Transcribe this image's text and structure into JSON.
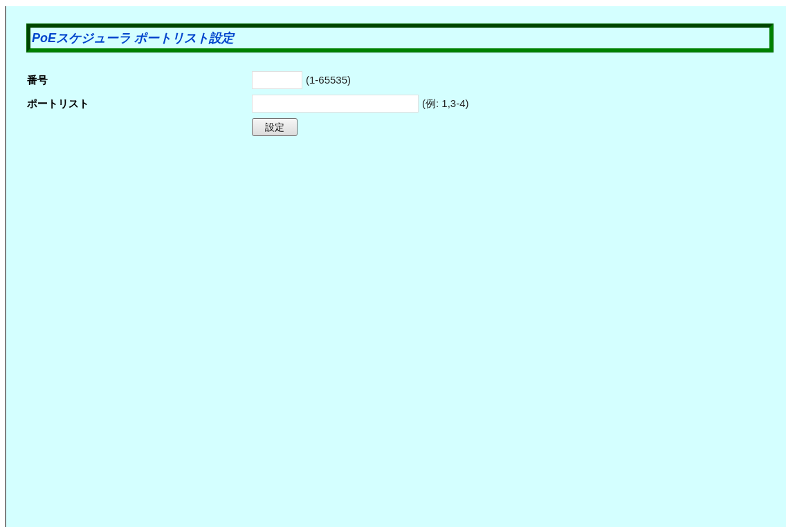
{
  "title": "PoEスケジューラ ポートリスト設定",
  "fields": [
    {
      "label": "番号",
      "hint": "(1-65535)",
      "kind": "short"
    },
    {
      "label": "ポートリスト",
      "hint": "(例: 1,3-4)",
      "kind": "long"
    }
  ],
  "button": "設定"
}
